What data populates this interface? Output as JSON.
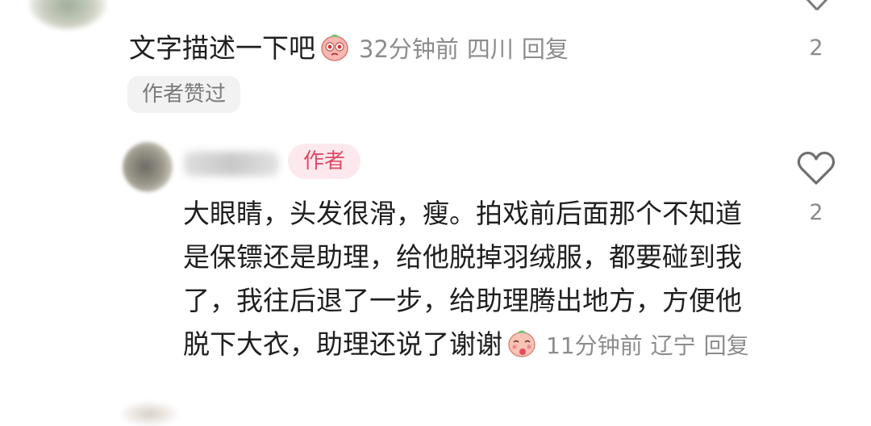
{
  "top_comment": {
    "text": "文字描述一下吧",
    "emoji": "crying-peach-emoji",
    "time": "32分钟前",
    "location": "四川",
    "reply_label": "回复",
    "tag": "作者赞过",
    "like_count": "2"
  },
  "reply_comment": {
    "badge": "作者",
    "text": "大眼睛，头发很滑，瘦。拍戏前后面那个不知道是保镖还是助理，给他脱掉羽绒服，都要碰到我了，我往后退了一步，给助理腾出地方，方便他脱下大衣，助理还说了谢谢",
    "emoji": "blushing-peach-emoji",
    "time": "11分钟前",
    "location": "辽宁",
    "reply_label": "回复",
    "like_count": "2"
  },
  "colors": {
    "badge_bg": "#fde9ed",
    "badge_text": "#e04a67",
    "meta_text": "#8c8c8c"
  }
}
